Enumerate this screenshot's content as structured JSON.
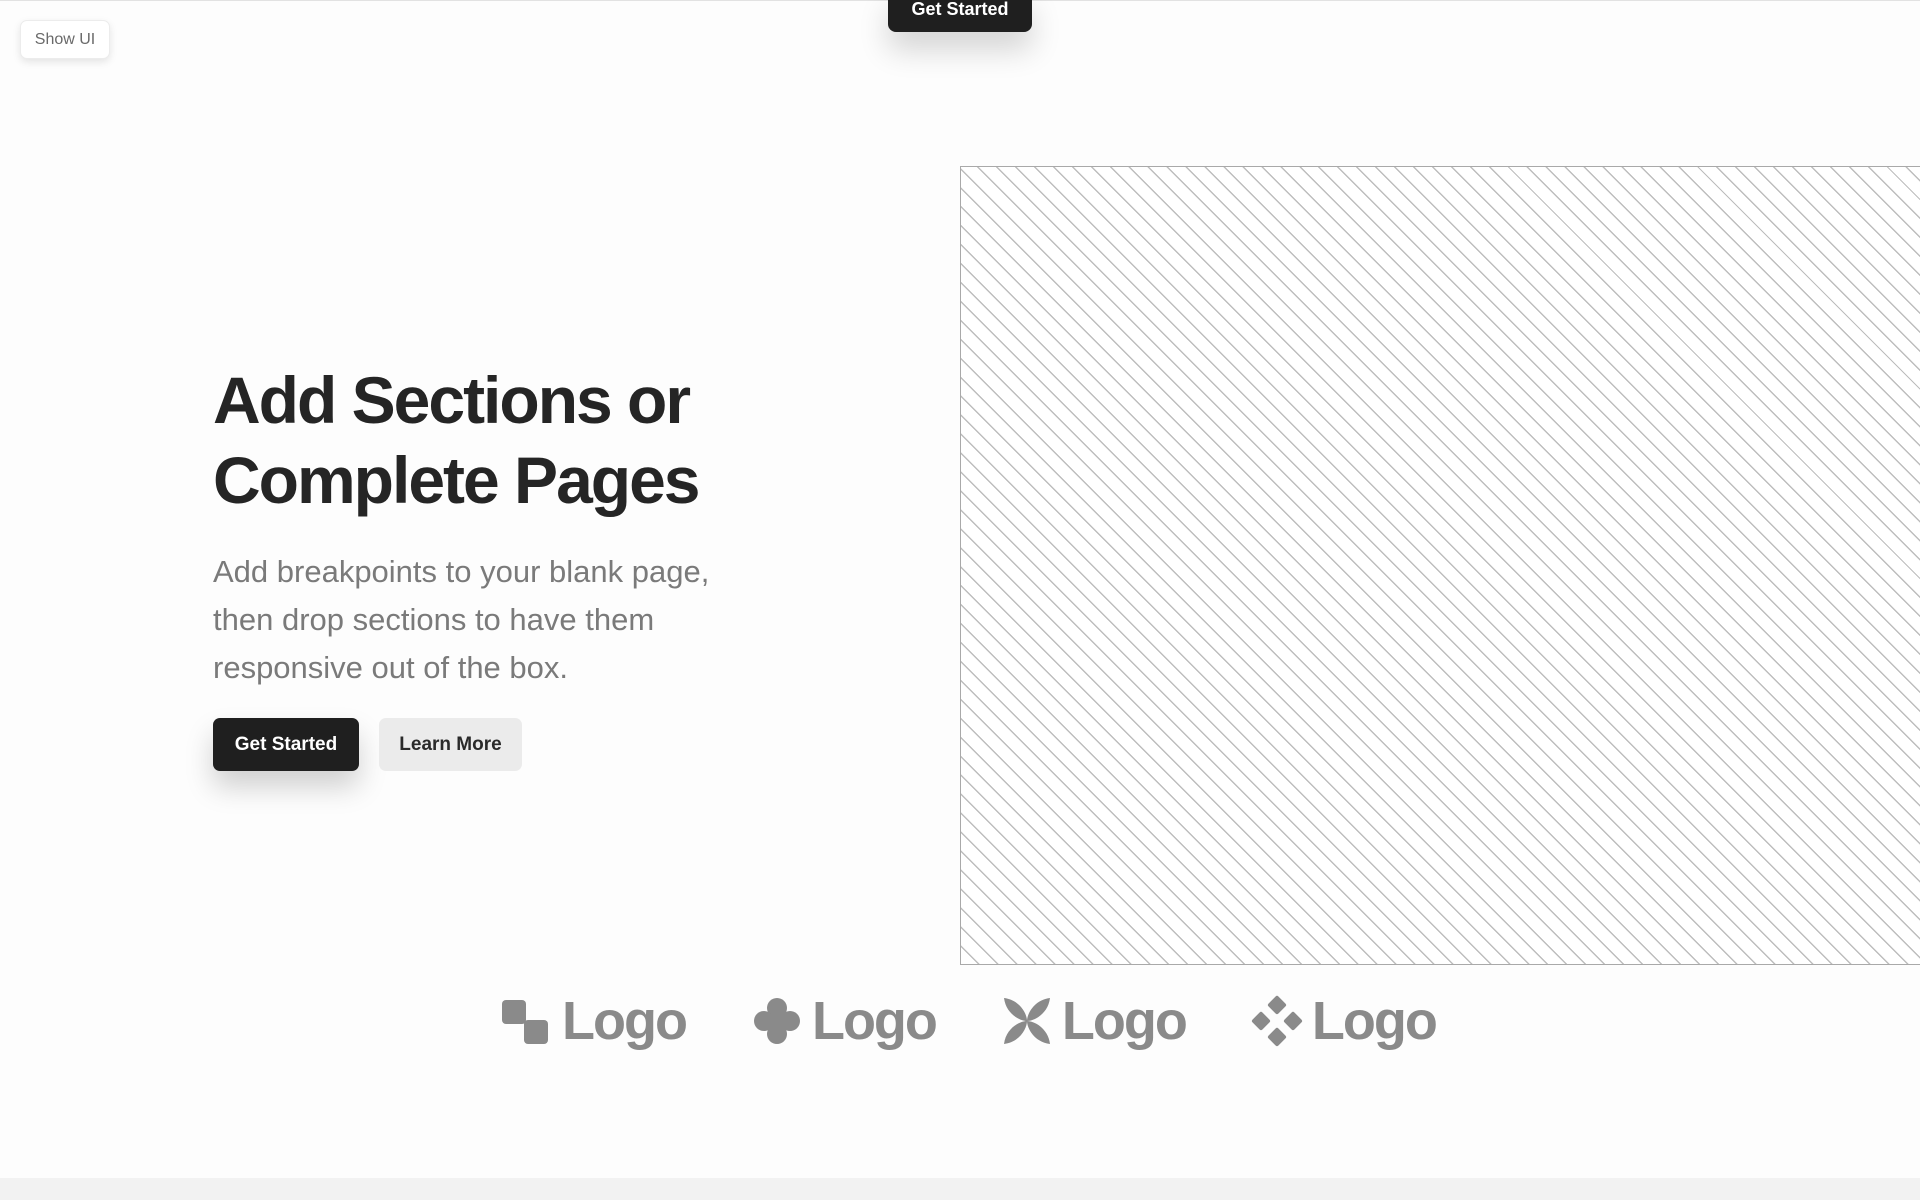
{
  "top_bar": {
    "show_ui_label": "Show UI",
    "cta_label": "Get Started"
  },
  "hero": {
    "title_lines": [
      "Add Sections or",
      "Complete Pages"
    ],
    "subtitle_lines": [
      "Add breakpoints to your blank page,",
      "then drop sections to have them",
      "responsive out of the box."
    ],
    "primary_button": "Get Started",
    "secondary_button": "Learn More"
  },
  "logos": [
    {
      "icon": "squares-logo-icon",
      "label": "Logo"
    },
    {
      "icon": "clover-logo-icon",
      "label": "Logo"
    },
    {
      "icon": "x-petals-logo-icon",
      "label": "Logo"
    },
    {
      "icon": "diamond-dots-logo-icon",
      "label": "Logo"
    }
  ],
  "colors": {
    "background": "#fdfdfd",
    "primary_button": "#1f1f1f",
    "secondary_button": "#ebebeb",
    "title": "#252525",
    "subtitle": "#7a7a7a",
    "logo": "#8a8a8a"
  }
}
